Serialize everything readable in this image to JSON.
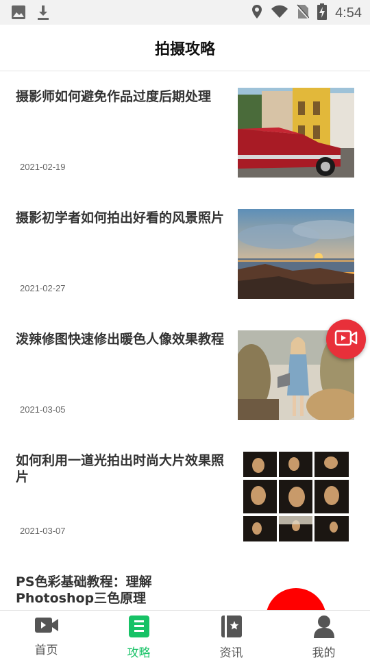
{
  "status_bar": {
    "time": "4:54",
    "icons": [
      "image-icon",
      "download-icon",
      "location-icon",
      "wifi-icon",
      "no-sim-icon",
      "battery-charging-icon"
    ]
  },
  "header": {
    "title": "拍摄攻略"
  },
  "articles": [
    {
      "title": "摄影师如何避免作品过度后期处理",
      "date": "2021-02-19",
      "thumb": "red-vintage-car-street"
    },
    {
      "title": "摄影初学者如何拍出好看的风景照片",
      "date": "2021-02-27",
      "thumb": "sunset-seascape"
    },
    {
      "title": "泼辣修图快速修出暖色人像效果教程",
      "date": "2021-03-05",
      "thumb": "woman-portrait-plants"
    },
    {
      "title": "如何利用一道光拍出时尚大片效果照片",
      "date": "2021-03-07",
      "thumb": "portrait-grid-dark"
    },
    {
      "title": "PS色彩基础教程：理解Photoshop三色原理",
      "date": "",
      "thumb": "rgb-color-circles"
    }
  ],
  "fab": {
    "icon": "video-camera-icon",
    "color": "#e8303a"
  },
  "bottom_nav": {
    "active_color": "#17c266",
    "items": [
      {
        "label": "首页",
        "icon": "video-icon",
        "active": false
      },
      {
        "label": "攻略",
        "icon": "list-icon",
        "active": true
      },
      {
        "label": "资讯",
        "icon": "bookmark-book-icon",
        "active": false
      },
      {
        "label": "我的",
        "icon": "person-icon",
        "active": false
      }
    ]
  }
}
